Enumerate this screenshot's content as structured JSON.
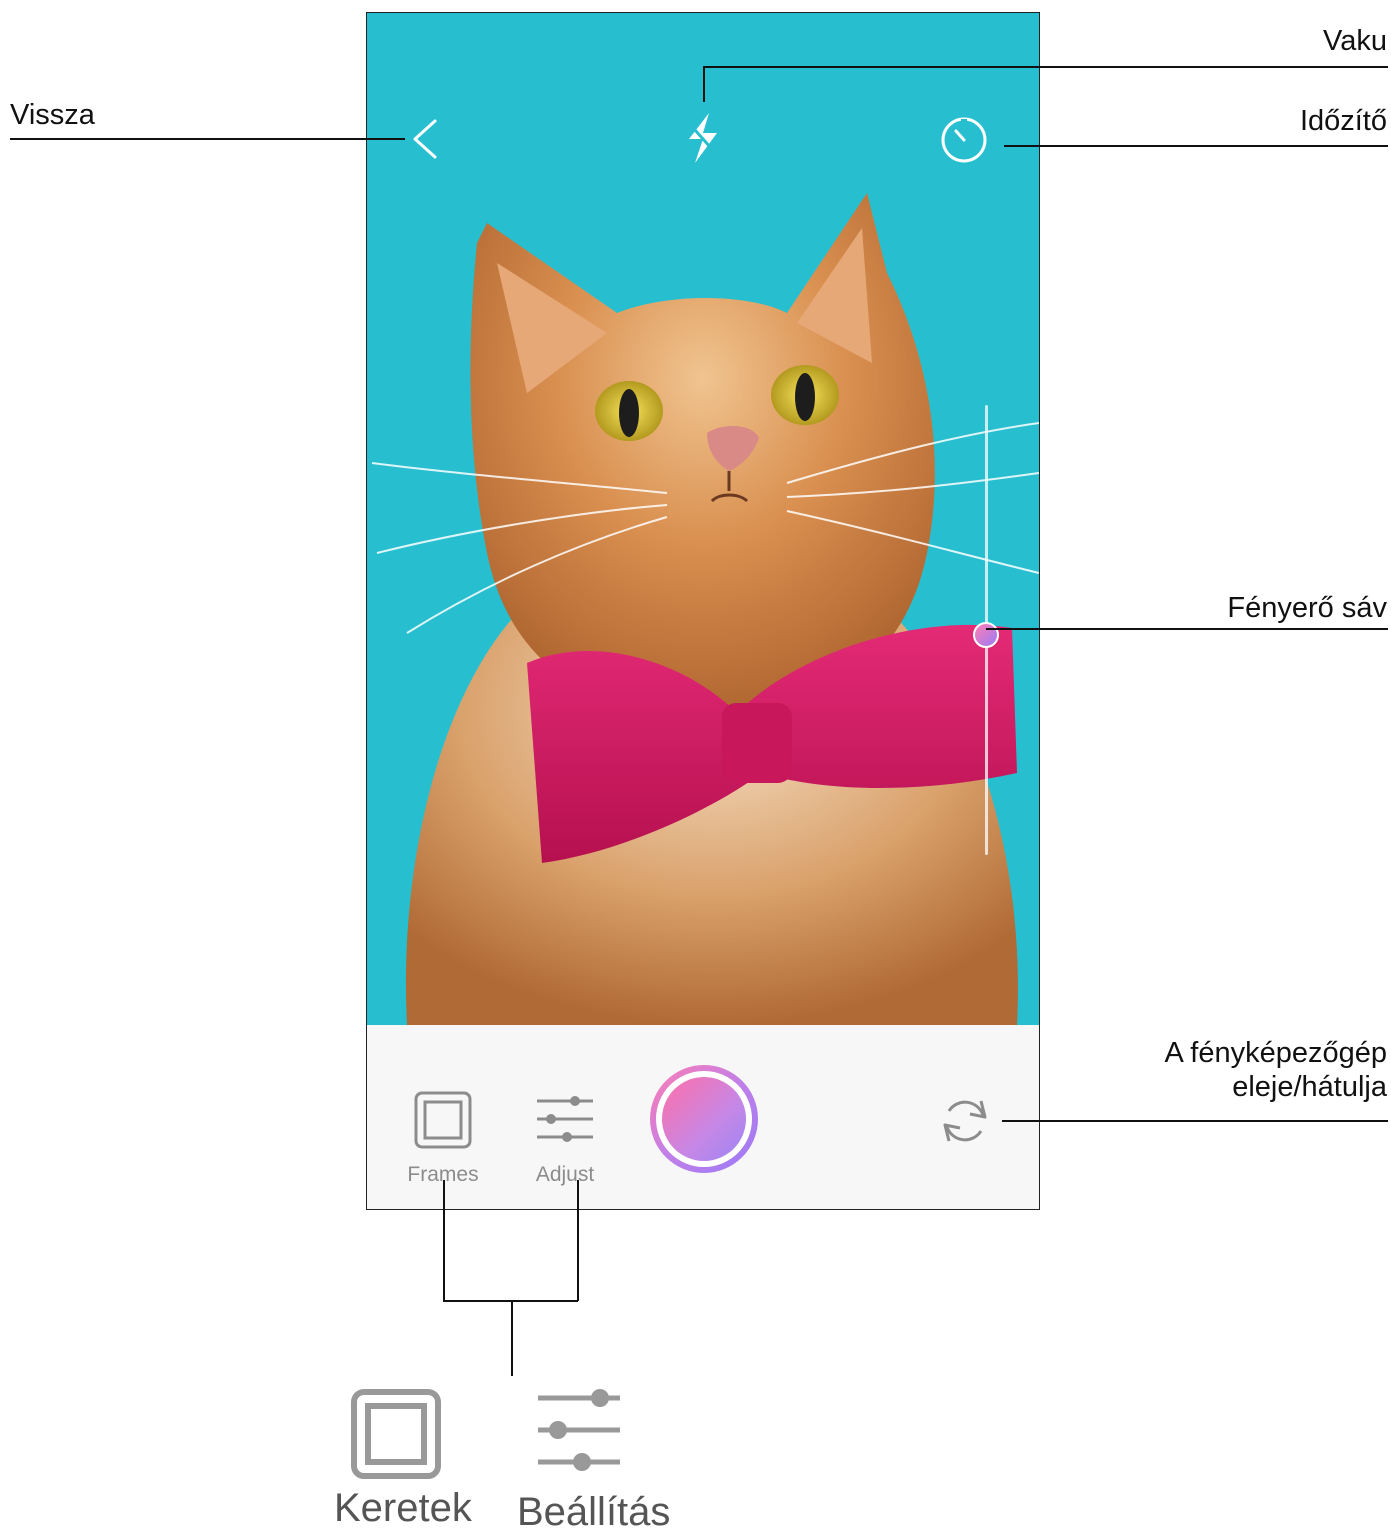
{
  "callouts": {
    "back": "Vissza",
    "flash": "Vaku",
    "timer": "Időzítő",
    "brightness": "Fényerő sáv",
    "flip_camera_line1": "A fényképezőgép",
    "flip_camera_line2": "eleje/hátulja"
  },
  "toolbar": {
    "frames_label": "Frames",
    "adjust_label": "Adjust"
  },
  "legend": {
    "frames_label": "Keretek",
    "adjust_label": "Beállítás"
  },
  "brightness_level": 0.51,
  "colors": {
    "sky": "#27bfcf",
    "shutter_gradient_start": "#ff7eb3",
    "shutter_gradient_end": "#9b7bf7",
    "bow_tie": "#d31a63",
    "cat_fur": "#d0874b"
  },
  "icons": [
    "chevron-left-icon",
    "flash-icon",
    "timer-icon",
    "frames-icon",
    "adjust-sliders-icon",
    "shutter-button",
    "flip-camera-icon"
  ]
}
